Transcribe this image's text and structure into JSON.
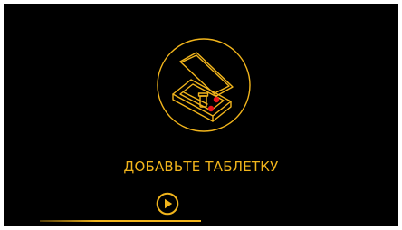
{
  "screen": {
    "instruction_text": "ДОБАВЬТЕ ТАБЛЕТКУ",
    "illustration_icon": "pill-dispenser-box-icon",
    "play_icon": "play-circle-icon",
    "progress_fraction": 1.0
  },
  "colors": {
    "background": "#000000",
    "accent": "#f2b51c",
    "indicator_red": "#e8151b"
  }
}
